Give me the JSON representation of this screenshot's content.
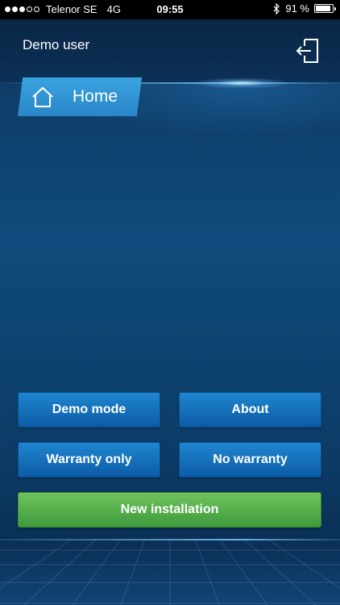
{
  "status_bar": {
    "carrier": "Telenor SE",
    "network": "4G",
    "time": "09:55",
    "battery_text": "91 %",
    "battery_level": 0.91,
    "signal_bars_filled": 3,
    "signal_bars_total": 5,
    "icons": [
      "signal-dots-icon",
      "bluetooth-icon",
      "battery-icon"
    ]
  },
  "header": {
    "user": "Demo user",
    "logout_icon": "logout-icon"
  },
  "nav": {
    "home_label": "Home",
    "home_icon": "home-icon"
  },
  "buttons": {
    "demo_mode": "Demo mode",
    "about": "About",
    "warranty_only": "Warranty only",
    "no_warranty": "No warranty",
    "new_installation": "New installation"
  },
  "colors": {
    "background": "#0f4b7c",
    "tab": "#2a86c8",
    "button_blue": "#0c5ca7",
    "button_green": "#4fa84a"
  }
}
